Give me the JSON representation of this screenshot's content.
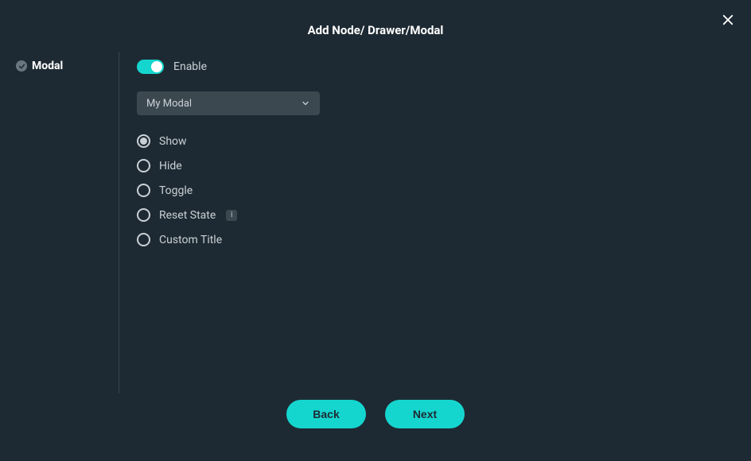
{
  "header": {
    "title": "Add Node/ Drawer/Modal"
  },
  "sidebar": {
    "items": [
      {
        "label": "Modal",
        "checked": true
      }
    ]
  },
  "content": {
    "enable": {
      "label": "Enable",
      "value": true
    },
    "select": {
      "value": "My Modal"
    },
    "actions": [
      {
        "label": "Show",
        "selected": true,
        "info": false
      },
      {
        "label": "Hide",
        "selected": false,
        "info": false
      },
      {
        "label": "Toggle",
        "selected": false,
        "info": false
      },
      {
        "label": "Reset State",
        "selected": false,
        "info": true
      },
      {
        "label": "Custom Title",
        "selected": false,
        "info": false
      }
    ]
  },
  "footer": {
    "back": "Back",
    "next": "Next"
  },
  "info_symbol": "i"
}
